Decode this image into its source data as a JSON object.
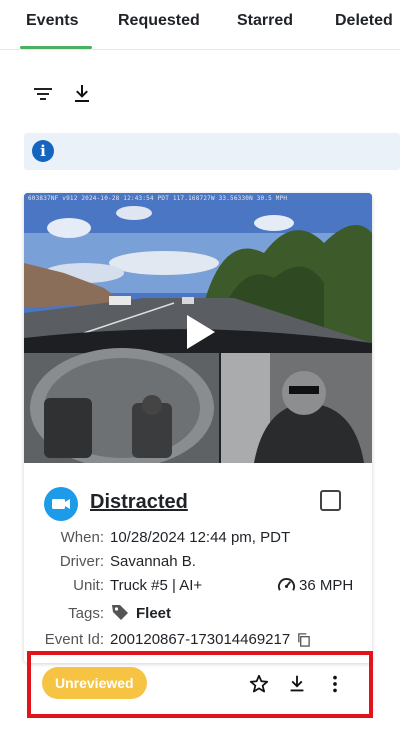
{
  "tabs": [
    {
      "label": "Events",
      "active": true
    },
    {
      "label": "Requested"
    },
    {
      "label": "Starred"
    },
    {
      "label": "Deleted"
    }
  ],
  "toolbar": {
    "filter_icon": "filter-icon",
    "download_icon": "download-icon"
  },
  "info_banner": {
    "icon": "info-icon",
    "text": ""
  },
  "event": {
    "video_overlay": "603837NF v912 2024-10-28 12:43:54 PDT 117.168727W 33.56330N 30.5 MPH",
    "title": "Distracted",
    "fields": {
      "when_label": "When:",
      "when_value": "10/28/2024 12:44 pm, PDT",
      "driver_label": "Driver:",
      "driver_value": "Savannah B.",
      "unit_label": "Unit:",
      "unit_value": "Truck #5 | AI+",
      "speed_value": "36 MPH",
      "tags_label": "Tags:",
      "tags_value": "Fleet",
      "event_id_label": "Event Id:",
      "event_id_value": "200120867-173014469217"
    },
    "status": "Unreviewed",
    "status_color": "#f6c343"
  },
  "colors": {
    "accent": "#4caf63",
    "info": "#1565c0",
    "camera": "#1e9be8",
    "highlight": "#e3131b"
  }
}
